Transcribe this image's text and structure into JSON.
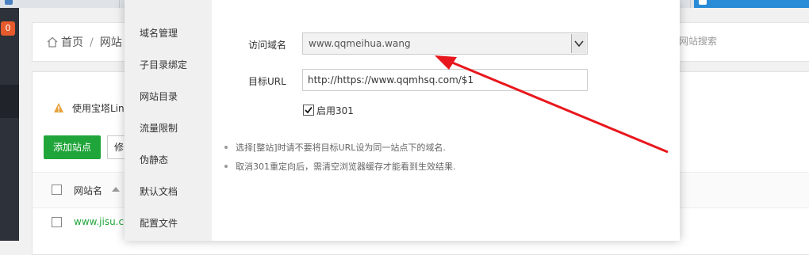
{
  "colors": {
    "accent_green": "#20a53a",
    "badge_orange": "#e65a2b",
    "annotation_red": "#e8171d",
    "active_tab_blue": "#2a8bd6"
  },
  "browser_tabs": [
    {
      "label": "",
      "active": false
    },
    {
      "label": "",
      "active": false
    },
    {
      "label": "",
      "active": false
    },
    {
      "label": "",
      "active": false
    },
    {
      "label": "",
      "active": false
    },
    {
      "label": "",
      "active": true
    }
  ],
  "sidebar": {
    "badge": "0"
  },
  "breadcrumb": {
    "home": "首页",
    "separator": "/",
    "current": "网站"
  },
  "search": {
    "placeholder": "网站搜索"
  },
  "notice": {
    "text": "使用宝塔Lin"
  },
  "toolbar": {
    "add_site": "添加站点",
    "modify": "修"
  },
  "table": {
    "column_site_name": "网站名",
    "rows": [
      {
        "site": "www.jisu.co"
      }
    ]
  },
  "modal": {
    "nav": [
      "域名管理",
      "子目录绑定",
      "网站目录",
      "流量限制",
      "伪静态",
      "默认文档",
      "配置文件"
    ],
    "domain_label": "访问域名",
    "domain_value": "www.qqmeihua.wang",
    "target_label": "目标URL",
    "target_value": "http://https://www.qqmhsq.com/$1",
    "enable301_label": "启用301",
    "enable301_checked": true,
    "tips": [
      "选择[整站]时请不要将目标URL设为同一站点下的域名.",
      "取消301重定向后，需清空浏览器缓存才能看到生效结果."
    ]
  },
  "icons": {
    "home": "home-icon",
    "warning": "warning-icon",
    "dropdown": "chevron-down-icon",
    "checkbox": "checkmark-icon",
    "annotation": "red-arrow-annotation"
  }
}
